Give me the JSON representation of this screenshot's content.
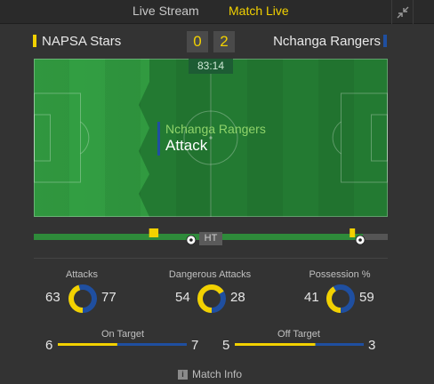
{
  "tabs": {
    "live_stream": "Live Stream",
    "match_live": "Match Live"
  },
  "icons": {
    "collapse": "collapse-arrows-icon",
    "goal": "football-icon",
    "card": "yellow-card-icon",
    "info": "info-icon"
  },
  "colors": {
    "home": "#f2d100",
    "away": "#1f4fa0",
    "accent_tab": "#f2d100",
    "pitch": "#2e8b3a"
  },
  "match": {
    "home_team": "NAPSA Stars",
    "away_team": "Nchanga Rangers",
    "home_score": "0",
    "away_score": "2",
    "clock": "83:14"
  },
  "event": {
    "team": "Nchanga Rangers",
    "label": "Attack"
  },
  "timeline": {
    "ht_label": "HT",
    "progress_fraction": 0.93,
    "home_events": [
      {
        "type": "yellow-card",
        "minute": 30
      },
      {
        "type": "yellow-card",
        "minute": 31
      },
      {
        "type": "yellow-card",
        "minute": 81
      }
    ],
    "away_events": [
      {
        "type": "goal",
        "minute": 40
      },
      {
        "type": "goal",
        "minute": 83
      }
    ]
  },
  "stats": {
    "attacks": {
      "label": "Attacks",
      "home": "63",
      "away": "77"
    },
    "dangerous": {
      "label": "Dangerous Attacks",
      "home": "54",
      "away": "28"
    },
    "possession": {
      "label": "Possession %",
      "home": "41",
      "away": "59"
    },
    "on_target": {
      "label": "On Target",
      "home": "6",
      "away": "7"
    },
    "off_target": {
      "label": "Off Target",
      "home": "5",
      "away": "3"
    }
  },
  "footer": {
    "match_info": "Match Info"
  }
}
